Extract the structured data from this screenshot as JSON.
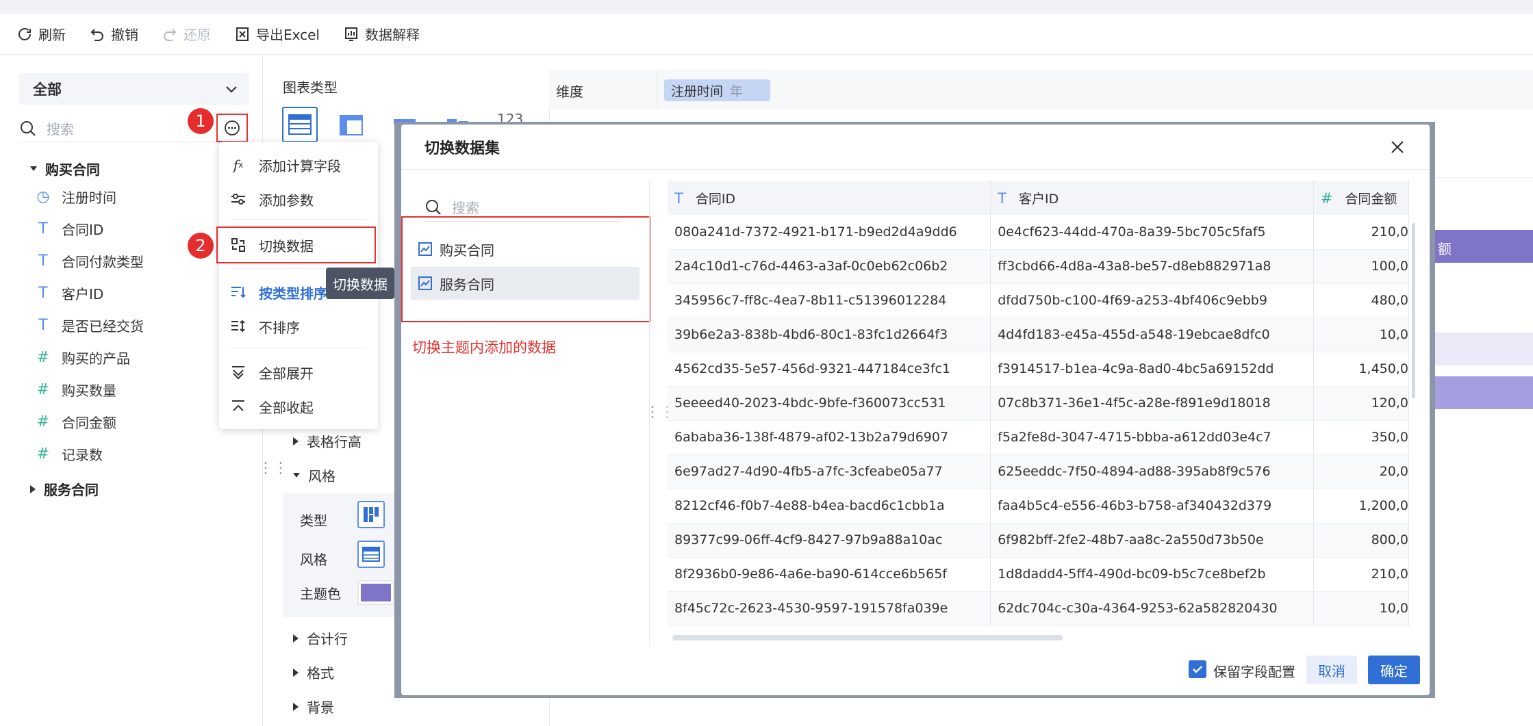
{
  "toolbar": {
    "refresh": "刷新",
    "undo": "撤销",
    "redo": "还原",
    "export_excel": "导出Excel",
    "data_explain": "数据解释"
  },
  "left_panel": {
    "scope": "全部",
    "search_placeholder": "搜索",
    "groups": [
      {
        "name": "购买合同",
        "expanded": true,
        "fields": [
          {
            "label": "注册时间",
            "type": "time"
          },
          {
            "label": "合同ID",
            "type": "text"
          },
          {
            "label": "合同付款类型",
            "type": "text"
          },
          {
            "label": "客户ID",
            "type": "text"
          },
          {
            "label": "是否已经交货",
            "type": "text"
          },
          {
            "label": "购买的产品",
            "type": "number"
          },
          {
            "label": "购买数量",
            "type": "number"
          },
          {
            "label": "合同金额",
            "type": "number"
          },
          {
            "label": "记录数",
            "type": "number"
          }
        ]
      },
      {
        "name": "服务合同",
        "expanded": false
      }
    ]
  },
  "badges": {
    "first": "1",
    "second": "2"
  },
  "more_menu": {
    "items": [
      {
        "label": "添加计算字段",
        "icon": "fx-icon"
      },
      {
        "label": "添加参数",
        "icon": "sliders-icon"
      },
      {
        "label": "切换数据",
        "icon": "switch-data-icon"
      },
      {
        "label": "按类型排序",
        "icon": "sort-by-type-icon"
      },
      {
        "label": "不排序",
        "icon": "no-sort-icon"
      },
      {
        "label": "全部展开",
        "icon": "expand-all-icon"
      },
      {
        "label": "全部收起",
        "icon": "collapse-all-icon"
      }
    ],
    "tooltip": "切换数据"
  },
  "middle_panel": {
    "chart_type_label": "图表类型",
    "chart_type_partial": "123",
    "sections": [
      "表格行高",
      "风格",
      "合计行",
      "格式",
      "背景"
    ],
    "style": {
      "type_label": "类型",
      "style_label": "风格",
      "theme_color_label": "主题色",
      "theme_color": "#7e74c8"
    }
  },
  "right_panel": {
    "dimension_label": "维度",
    "dimension_chip": "注册时间",
    "dimension_chip_sub": "年",
    "partial_header": "额"
  },
  "modal": {
    "title": "切换数据集",
    "search_placeholder": "搜索",
    "datasets": [
      "购买合同",
      "服务合同"
    ],
    "selected_dataset": "服务合同",
    "hint": "切换主题内添加的数据",
    "columns": [
      "合同ID",
      "客户ID",
      "合同金额"
    ],
    "rows": [
      [
        "080a241d-7372-4921-b171-b9ed2d4a9dd6",
        "0e4cf623-44dd-470a-8a39-5bc705c5faf5",
        "210,0"
      ],
      [
        "2a4c10d1-c76d-4463-a3af-0c0eb62c06b2",
        "ff3cbd66-4d8a-43a8-be57-d8eb882971a8",
        "100,0"
      ],
      [
        "345956c7-ff8c-4ea7-8b11-c51396012284",
        "dfdd750b-c100-4f69-a253-4bf406c9ebb9",
        "480,0"
      ],
      [
        "39b6e2a3-838b-4bd6-80c1-83fc1d2664f3",
        "4d4fd183-e45a-455d-a548-19ebcae8dfc0",
        "10,0"
      ],
      [
        "4562cd35-5e57-456d-9321-447184ce3fc1",
        "f3914517-b1ea-4c9a-8ad0-4bc5a69152dd",
        "1,450,0"
      ],
      [
        "5eeeed40-2023-4bdc-9bfe-f360073cc531",
        "07c8b371-36e1-4f5c-a28e-f891e9d18018",
        "120,0"
      ],
      [
        "6ababa36-138f-4879-af02-13b2a79d6907",
        "f5a2fe8d-3047-4715-bbba-a612dd03e4c7",
        "350,0"
      ],
      [
        "6e97ad27-4d90-4fb5-a7fc-3cfeabe05a77",
        "625eeddc-7f50-4894-ad88-395ab8f9c576",
        "20,0"
      ],
      [
        "8212cf46-f0b7-4e88-b4ea-bacd6c1cbb1a",
        "faa4b5c4-e556-46b3-b758-af340432d379",
        "1,200,0"
      ],
      [
        "89377c99-06ff-4cf9-8427-97b9a88a10ac",
        "6f982bff-2fe2-48b7-aa8c-2a550d73b50e",
        "800,0"
      ],
      [
        "8f2936b0-9e86-4a6e-ba90-614cce6b565f",
        "1d8dadd4-5ff4-490d-bc09-b5c7ce8bef2b",
        "210,0"
      ],
      [
        "8f45c72c-2623-4530-9597-191578fa039e",
        "62dc704c-c30a-4364-9253-62a582820430",
        "10,0"
      ]
    ],
    "keep_field_config": "保留字段配置",
    "keep_field_config_checked": true,
    "cancel": "取消",
    "ok": "确定"
  },
  "colors": {
    "accent": "#2f6fd6",
    "highlight_red": "#e5312f",
    "theme_purple": "#7e74c8"
  }
}
